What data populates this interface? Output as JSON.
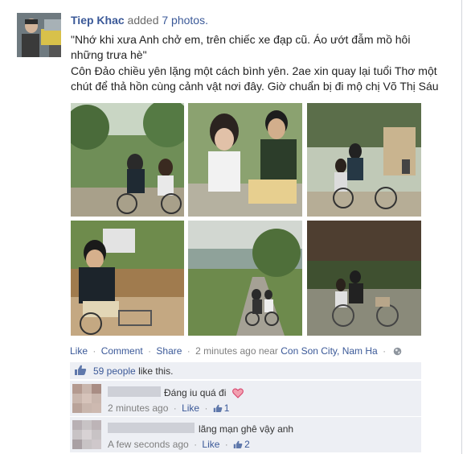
{
  "post": {
    "author": "Tiep Khac",
    "action_prefix": "added",
    "action_photos": "7 photos.",
    "line1": "\"Nhớ khi xưa Anh chở em, trên chiếc xe đạp cũ. Áo ướt đẫm mồ hôi những trưa hè\"",
    "line2": "Côn Đảo chiều yên lặng một cách bình yên. 2ae xin quay lại tuổi Thơ một chút để thả hồn cùng cảnh vật nơi đây. Giờ chuẩn bị đi mộ chị Võ Thị Sáu"
  },
  "actions": {
    "like": "Like",
    "comment": "Comment",
    "share": "Share",
    "time": "2 minutes ago",
    "near": "near",
    "location": "Con Son City, Nam Ha",
    "separator": "·"
  },
  "likes": {
    "count_text": "59 people",
    "suffix": "like this."
  },
  "comments": [
    {
      "text": "Đáng iu quá đi",
      "time": "2 minutes ago",
      "like_label": "Like",
      "like_count": "1"
    },
    {
      "text": "lãng mạn ghê vậy anh",
      "time": "A few seconds ago",
      "like_label": "Like",
      "like_count": "2"
    }
  ],
  "colors": {
    "link": "#3b5998",
    "ufi_bg": "#edeff4",
    "meta": "#7f7f7f",
    "heart": "#e0245e"
  },
  "icons": [
    "globe-icon",
    "thumbs-up-icon",
    "heart-icon"
  ]
}
